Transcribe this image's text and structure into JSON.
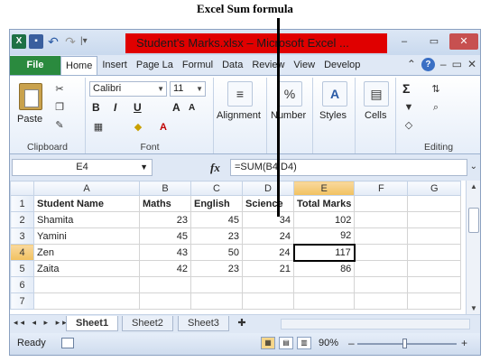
{
  "annotation": {
    "title": "Excel Sum formula"
  },
  "titlebar": {
    "title": "Student's Marks.xlsx – Microsoft Excel ...",
    "qat": {
      "app_icon": "X",
      "save_icon": "save-icon",
      "undo_icon": "undo-icon",
      "redo_icon": "redo-icon",
      "customize": "|▾"
    },
    "controls": {
      "minimize": "–",
      "restore": "▭",
      "close": "✕"
    }
  },
  "ribbon": {
    "file_tab": "File",
    "tabs": [
      "Home",
      "Insert",
      "Page La",
      "Formul",
      "Data",
      "Review",
      "View",
      "Develop"
    ],
    "active_tab": "Home",
    "clipboard": {
      "paste": "Paste",
      "label": "Clipboard"
    },
    "font": {
      "name": "Calibri",
      "size": "11",
      "bold": "B",
      "italic": "I",
      "underline": "U",
      "grow": "A",
      "shrink": "A",
      "label": "Font"
    },
    "alignment": {
      "label": "Alignment"
    },
    "number": {
      "label": "Number",
      "icon_text": "%"
    },
    "styles": {
      "label": "Styles"
    },
    "cells": {
      "label": "Cells"
    },
    "editing": {
      "label": "Editing",
      "sum": "Σ"
    }
  },
  "formula_bar": {
    "name_box": "E4",
    "fx": "fx",
    "formula": "=SUM(B4:D4)"
  },
  "sheet": {
    "columns": [
      "A",
      "B",
      "C",
      "D",
      "E",
      "F",
      "G"
    ],
    "selected_column": "E",
    "rows": [
      {
        "n": "1",
        "cells": [
          "Student Name",
          "Maths",
          "English",
          "Science",
          "Total Marks",
          "",
          ""
        ]
      },
      {
        "n": "2",
        "cells": [
          "Shamita",
          "23",
          "45",
          "34",
          "102",
          "",
          ""
        ]
      },
      {
        "n": "3",
        "cells": [
          "Yamini",
          "45",
          "23",
          "24",
          "92",
          "",
          ""
        ]
      },
      {
        "n": "4",
        "cells": [
          "Zen",
          "43",
          "50",
          "24",
          "117",
          "",
          ""
        ]
      },
      {
        "n": "5",
        "cells": [
          "Zaita",
          "42",
          "23",
          "21",
          "86",
          "",
          ""
        ]
      },
      {
        "n": "6",
        "cells": [
          "",
          "",
          "",
          "",
          "",
          "",
          ""
        ]
      },
      {
        "n": "7",
        "cells": [
          "",
          "",
          "",
          "",
          "",
          "",
          ""
        ]
      }
    ],
    "selected_row": "4",
    "active_cell": "E4"
  },
  "sheet_tabs": {
    "nav": "◂◂ ◂ ▸ ▸▸",
    "tabs": [
      "Sheet1",
      "Sheet2",
      "Sheet3"
    ],
    "active": "Sheet1"
  },
  "status_bar": {
    "state": "Ready",
    "zoom": "90%",
    "zoom_out": "–",
    "zoom_in": "+"
  }
}
